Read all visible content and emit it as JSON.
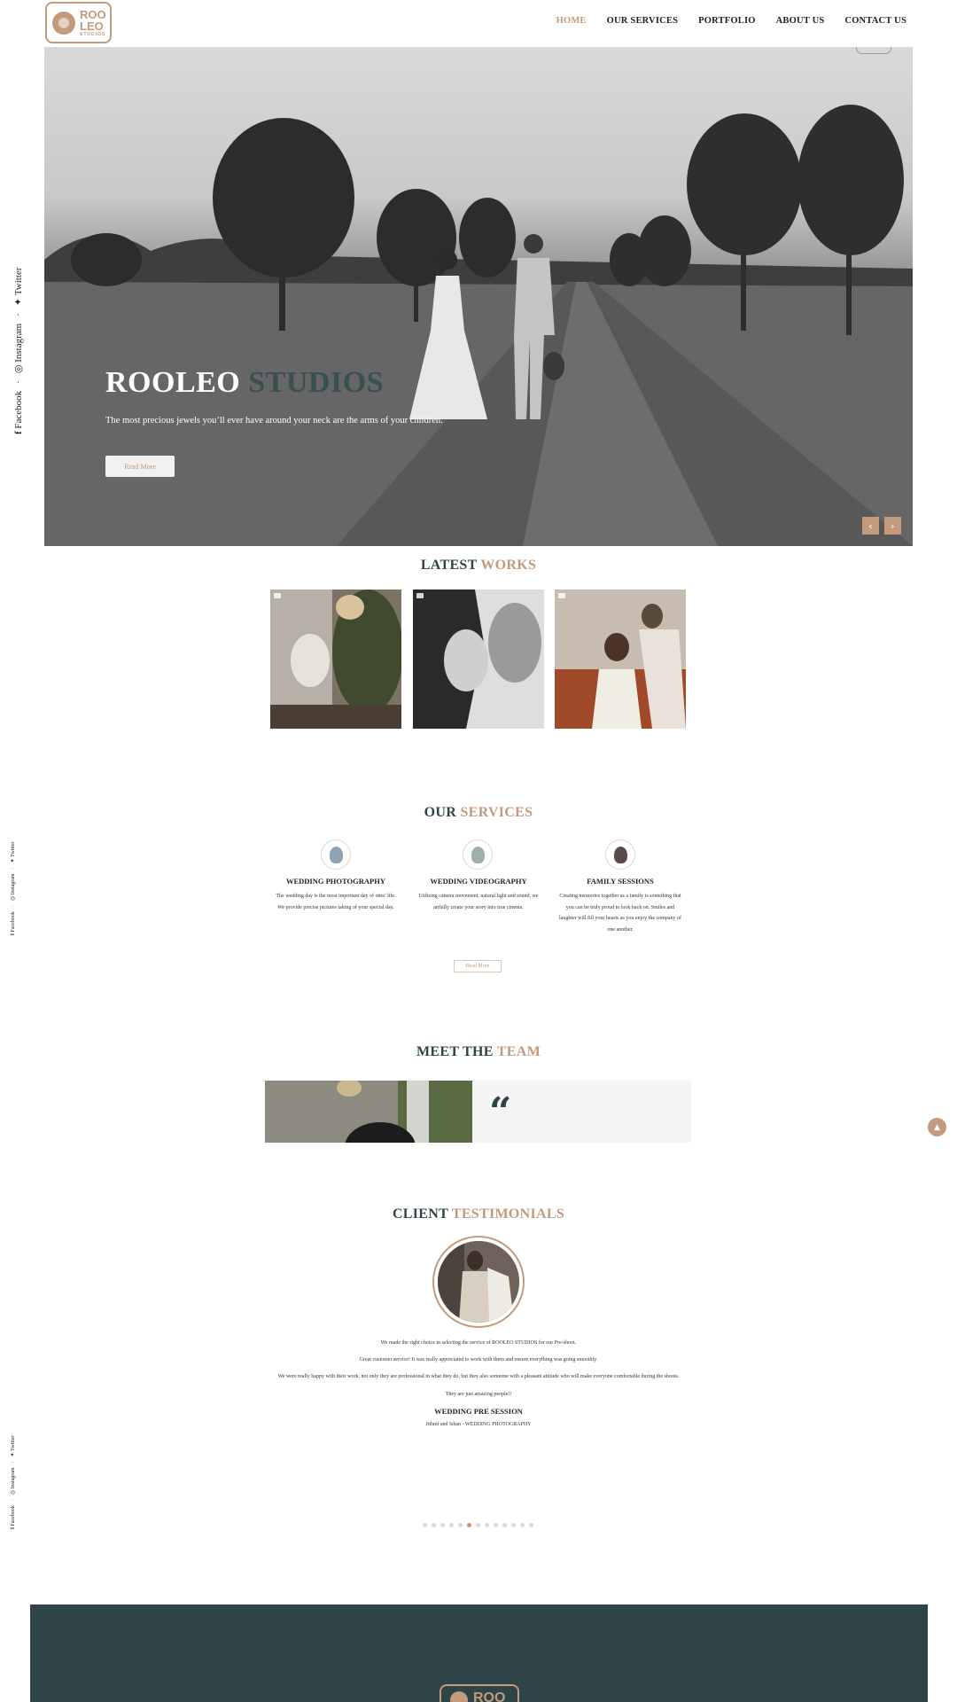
{
  "brand": {
    "logo_line1": "ROO",
    "logo_line2": "LEO",
    "logo_small": "STUDIOS",
    "accent_color": "#c39a7c",
    "dark_color": "#2f4446"
  },
  "nav": {
    "items": [
      "HOME",
      "OUR SERVICES",
      "PORTFOLIO",
      "ABOUT US",
      "CONTACT US"
    ],
    "active": "HOME"
  },
  "hero": {
    "title_main": "ROOLEO",
    "title_accent": "STUDIOS",
    "subtitle": "The most precious jewels you’ll ever have around your neck are the arms of your children.",
    "button": "Read More",
    "prev_icon": "chevron-left-icon",
    "next_icon": "chevron-right-icon"
  },
  "social": {
    "facebook": "Facebook",
    "instagram": "Instagram",
    "twitter": "Twitter",
    "separator": "·"
  },
  "latest_works": {
    "title_main": "LATEST",
    "title_accent": "WORKS"
  },
  "services": {
    "title_main": "OUR",
    "title_accent": "SERVICES",
    "items": [
      {
        "title": "WEDDING PHOTOGRAPHY",
        "text": "The wedding day is the most important day of ones' life. We provide precise pictures taking of your special day."
      },
      {
        "title": "WEDDING VIDEOGRAPHY",
        "text": "Utilizing camera movement, natural light and sound, we artfully create your story into true cinema."
      },
      {
        "title": "FAMILY SESSIONS",
        "text": "Creating memories together as a family is something that you can be truly proud to look back on. Smiles and laughter will fill your hearts as you enjoy the company of one another."
      }
    ],
    "button": "Read More"
  },
  "team": {
    "title_main": "MEET THE",
    "title_accent": "TEAM",
    "quote_mark": "“"
  },
  "testimonials": {
    "title_main": "CLIENT",
    "title_accent": "TESTIMONIALS",
    "lines": [
      "We made the right choice in selecting the service of ROOLEO STUDIOS for our Pre-shoot.",
      "Great customer service! It was really appreciated to work with them and ensure everything was going smoothly.",
      "We were really happy with their work, not only they are professional in what they do, but they also someone with a pleasant attitude who will make everyone comfortable during the shoots.",
      "They are just amazing people!!"
    ],
    "heading": "WEDDING PRE SESSION",
    "author": "Jithmi and Ishan - WEDDING PHOTOGRAPHY",
    "dot_count": 13,
    "active_dot": 5
  },
  "scroll_top_icon": "chevron-up-icon",
  "footer": {
    "logo_text": "ROO"
  }
}
